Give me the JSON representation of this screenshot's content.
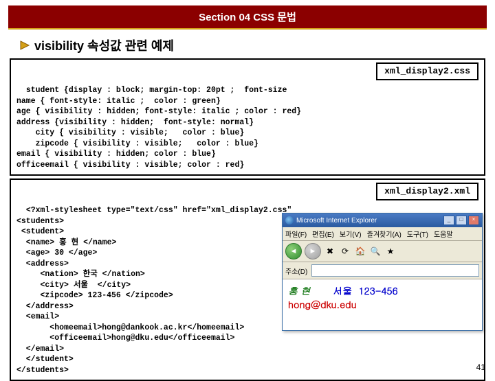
{
  "header": "Section 04 CSS 문법",
  "title": "visibility 속성값 관련 예제",
  "css_box": {
    "file_label": "xml_display2.css",
    "code": "student {display : block; margin-top: 20pt ;  font-size\nname { font-style: italic ;  color : green}\nage { visibility : hidden; font-style: italic ; color : red}\naddress {visibility : hidden;  font-style: normal}\n    city { visibility : visible;   color : blue}\n    zipcode { visibility : visible;   color : blue}\nemail { visibility : hidden; color : blue}\nofficeemail { visibility : visible; color : red}"
  },
  "xml_box": {
    "file_label": "xml_display2.xml",
    "code": "<?xml-stylesheet type=\"text/css\" href=\"xml_display2.css\"\n<students>\n <student>\n  <name> 홍 현 </name>\n  <age> 30 </age>\n  <address>\n     <nation> 한국 </nation>\n     <city> 서울  </city>\n     <zipcode> 123-456 </zipcode>\n  </address>\n  <email>\n       <homeemail>hong@dankook.ac.kr</homeemail>\n       <officeemail>hong@dku.edu</officeemail>\n  </email>\n  </student>\n</students>"
  },
  "browser": {
    "title_text": "Microsoft Internet Explorer",
    "menu": [
      "파일(F)",
      "편집(E)",
      "보기(V)",
      "즐겨찾기(A)",
      "도구(T)",
      "도움말"
    ],
    "addr_label": "주소(D)",
    "addr_value": "",
    "rendered": {
      "name": "홍 현",
      "city": "서울",
      "zip": "123-456",
      "office": "hong@dku.edu"
    }
  },
  "page_number": "41"
}
